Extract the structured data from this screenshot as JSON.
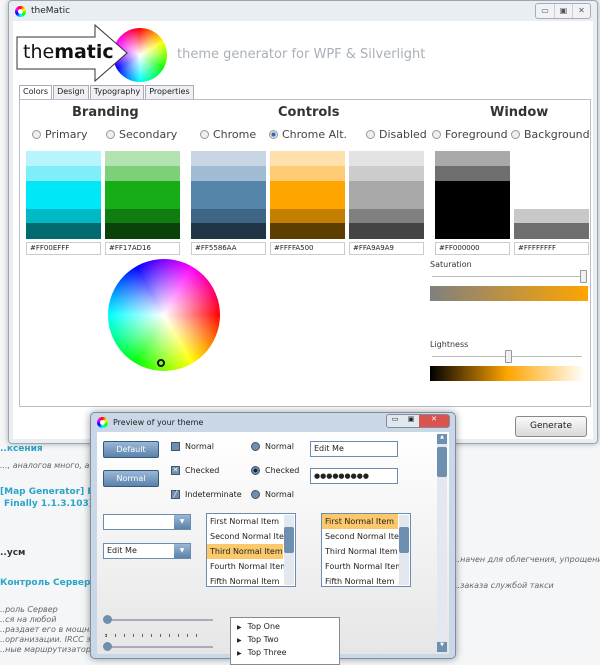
{
  "background": {
    "fragments": [
      "..ксения",
      "..., аналогов много, а",
      "[Map Generator] Full",
      "Finally 1.1.3.103]",
      "..усм",
      "Контроль Сервер",
      "..роль Сервер",
      "..ся на любой",
      "..раздает его в мощный",
      "..организации. IRCC это",
      "..ные маршрутизатор,",
      "..начен для облегчения, упрощени",
      "..заказа службой такси"
    ]
  },
  "main_window": {
    "title": "theMatic",
    "logo_text_light": "the",
    "logo_text_bold": "matic",
    "tagline": "theme generator for WPF & Silverlight",
    "tabs": [
      "Colors",
      "Design",
      "Typography",
      "Properties"
    ],
    "active_tab": "Colors",
    "sections": {
      "branding": "Branding",
      "controls": "Controls",
      "window": "Window"
    },
    "swatches": [
      {
        "label": "Primary",
        "hex": "#FF00EFFF",
        "selected": false,
        "colors": [
          "#b8f4fb",
          "#7feef9",
          "#00e7f7",
          "#00b9c4",
          "#006a70"
        ]
      },
      {
        "label": "Secondary",
        "hex": "#FF17AD16",
        "selected": false,
        "colors": [
          "#b5e2b2",
          "#7dd07a",
          "#17ad16",
          "#0f7d0f",
          "#094309"
        ]
      },
      {
        "label": "Chrome",
        "hex": "#FF5586AA",
        "selected": false,
        "colors": [
          "#c8d6e4",
          "#a0bcd3",
          "#5586aa",
          "#3f6584",
          "#213546"
        ]
      },
      {
        "label": "Chrome Alt.",
        "hex": "#FFFFA500",
        "selected": true,
        "colors": [
          "#ffe0ad",
          "#ffcb74",
          "#ffa500",
          "#c47f00",
          "#5e3e00"
        ]
      },
      {
        "label": "Disabled",
        "hex": "#FFA9A9A9",
        "selected": false,
        "colors": [
          "#e3e3e3",
          "#cccccc",
          "#a9a9a9",
          "#808080",
          "#444444"
        ]
      },
      {
        "label": "Foreground",
        "hex": "#FF000000",
        "selected": false,
        "colors": [
          "#a9a9a9",
          "#6e6e6e",
          "#000000",
          "#000000",
          "#000000"
        ]
      },
      {
        "label": "Background",
        "hex": "#FFFFFFFF",
        "selected": false,
        "colors": [
          "#ffffff",
          "#ffffff",
          "#ffffff",
          "#c8c8c8",
          "#6e6e6e"
        ]
      }
    ],
    "saturation": {
      "label": "Saturation",
      "value": 1.0
    },
    "lightness": {
      "label": "Lightness",
      "value": 0.5
    },
    "accent": "#FFA500",
    "generate_label": "Generate"
  },
  "preview": {
    "title": "Preview of your theme",
    "buttons": [
      "Default",
      "Normal"
    ],
    "checkboxes": [
      "Normal",
      "Checked",
      "Indeterminate"
    ],
    "radios": [
      "Normal",
      "Checked",
      "Normal"
    ],
    "textbox": "Edit Me",
    "password": "●●●●●●●●●",
    "combo1": "",
    "combo2": "Edit Me",
    "list1": {
      "items": [
        "First Normal Item",
        "Second Normal Item",
        "Third Normal Item",
        "Fourth Normal Item",
        "Fifth Normal Item"
      ],
      "selected": 2
    },
    "list2": {
      "items": [
        "First Normal Item",
        "Second Normal Item",
        "Third Normal Item",
        "Fourth Normal Item",
        "Fifth Normal Item"
      ],
      "selected": 0
    },
    "tree": [
      "Top One",
      "Top Two",
      "Top Three"
    ]
  }
}
